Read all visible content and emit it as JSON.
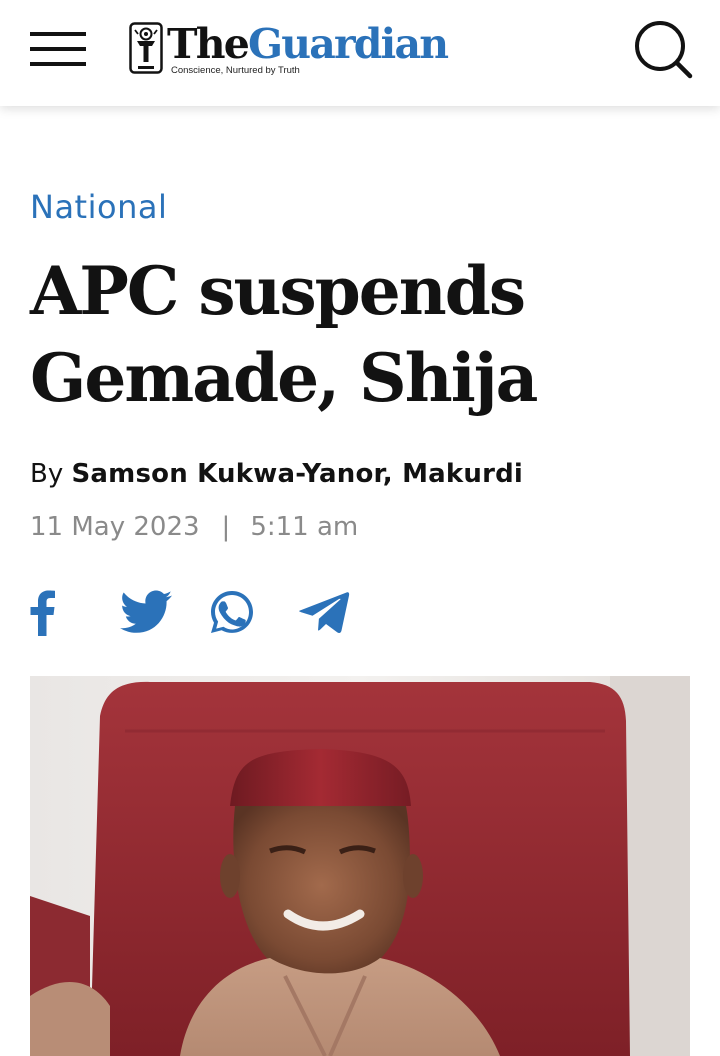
{
  "header": {
    "logo_the": "The",
    "logo_guardian": "Guardian",
    "logo_tagline": "Conscience, Nurtured by Truth",
    "menu_icon": "hamburger-menu-icon",
    "search_icon": "search-icon"
  },
  "article": {
    "category": "National",
    "headline_line1": "APC suspends",
    "headline_line2": "Gemade, Shija",
    "byline_prefix": "By",
    "author": "Samson Kukwa-Yanor, Makurdi",
    "date": "11 May 2023",
    "date_separator": "|",
    "time": "5:11 am"
  },
  "share": [
    {
      "network": "facebook",
      "icon": "facebook-icon",
      "color": "#2b72b9"
    },
    {
      "network": "twitter",
      "icon": "twitter-icon",
      "color": "#2b72b9"
    },
    {
      "network": "whatsapp",
      "icon": "whatsapp-icon",
      "color": "#2b72b9"
    },
    {
      "network": "telegram",
      "icon": "telegram-icon",
      "color": "#2b72b9"
    }
  ],
  "image": {
    "subject": "article-photo"
  },
  "colors": {
    "brand_blue": "#2b72b9",
    "text": "#121212",
    "meta_gray": "#8a8a8a"
  }
}
